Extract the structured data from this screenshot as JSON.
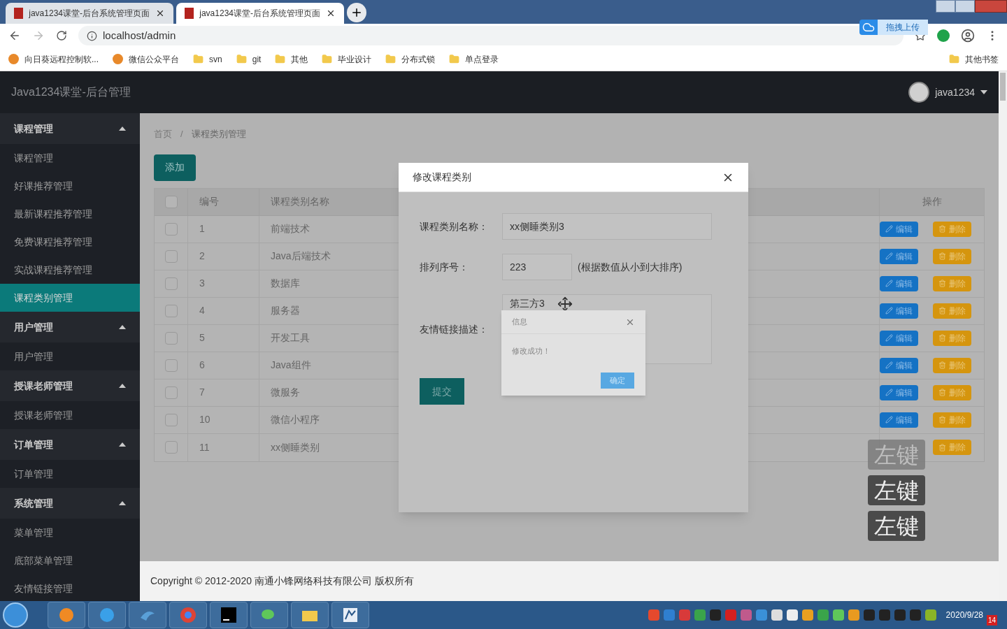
{
  "browser": {
    "tabs": [
      {
        "title": "java1234课堂-后台系统管理页面",
        "selected": false
      },
      {
        "title": "java1234课堂-后台系统管理页面",
        "selected": true
      }
    ],
    "address": "localhost/admin",
    "extension": "拖拽上传",
    "bookmarks": [
      {
        "label": "向日葵远程控制软...",
        "kind": "app"
      },
      {
        "label": "微信公众平台",
        "kind": "app"
      },
      {
        "label": "svn",
        "kind": "folder"
      },
      {
        "label": "git",
        "kind": "folder"
      },
      {
        "label": "其他",
        "kind": "folder"
      },
      {
        "label": "毕业设计",
        "kind": "folder"
      },
      {
        "label": "分布式锁",
        "kind": "folder"
      },
      {
        "label": "单点登录",
        "kind": "folder"
      }
    ],
    "other_bookmarks": "其他书签"
  },
  "header": {
    "brand": "Java1234课堂-后台管理",
    "user": "java1234"
  },
  "sidebar": [
    {
      "label": "课程管理",
      "expanded": true,
      "children": [
        {
          "label": "课程管理",
          "selected": false
        },
        {
          "label": "好课推荐管理",
          "selected": false
        },
        {
          "label": "最新课程推荐管理",
          "selected": false
        },
        {
          "label": "免费课程推荐管理",
          "selected": false
        },
        {
          "label": "实战课程推荐管理",
          "selected": false
        },
        {
          "label": "课程类别管理",
          "selected": true
        }
      ]
    },
    {
      "label": "用户管理",
      "expanded": true,
      "children": [
        {
          "label": "用户管理",
          "selected": false
        }
      ]
    },
    {
      "label": "授课老师管理",
      "expanded": true,
      "children": [
        {
          "label": "授课老师管理",
          "selected": false
        }
      ]
    },
    {
      "label": "订单管理",
      "expanded": true,
      "children": [
        {
          "label": "订单管理",
          "selected": false
        }
      ]
    },
    {
      "label": "系统管理",
      "expanded": true,
      "children": [
        {
          "label": "菜单管理",
          "selected": false
        },
        {
          "label": "底部菜单管理",
          "selected": false
        },
        {
          "label": "友情链接管理",
          "selected": false
        }
      ]
    }
  ],
  "breadcrumb": [
    "首页",
    "/",
    "课程类别管理"
  ],
  "add_button": "添加",
  "table": {
    "select_all_checked": false,
    "columns": [
      "编号",
      "课程类别名称",
      "操作"
    ],
    "rows": [
      {
        "id": "1",
        "name": "前端技术",
        "checked": false,
        "actions": [
          "编辑",
          "删除"
        ]
      },
      {
        "id": "2",
        "name": "Java后端技术",
        "checked": false,
        "actions": [
          "编辑",
          "删除"
        ]
      },
      {
        "id": "3",
        "name": "数据库",
        "checked": false,
        "actions": [
          "编辑",
          "删除"
        ]
      },
      {
        "id": "4",
        "name": "服务器",
        "checked": false,
        "actions": [
          "编辑",
          "删除"
        ]
      },
      {
        "id": "5",
        "name": "开发工具",
        "checked": false,
        "actions": [
          "编辑",
          "删除"
        ]
      },
      {
        "id": "6",
        "name": "Java组件",
        "checked": false,
        "actions": [
          "编辑",
          "删除"
        ]
      },
      {
        "id": "7",
        "name": "微服务",
        "checked": false,
        "actions": [
          "编辑",
          "删除"
        ]
      },
      {
        "id": "10",
        "name": "微信小程序",
        "checked": false,
        "actions": [
          "编辑",
          "删除"
        ]
      },
      {
        "id": "11",
        "name": "xx侧睡类别",
        "checked": false,
        "actions": [
          "删除"
        ]
      }
    ]
  },
  "modal": {
    "title": "修改课程类别",
    "fields": [
      {
        "label": "课程类别名称：",
        "value": "xx侧睡类别3",
        "kind": "input"
      },
      {
        "label": "排列序号：",
        "value": "223",
        "hint": "(根据数值从小到大排序)",
        "kind": "number"
      },
      {
        "label": "友情链接描述：",
        "value": "第三方3",
        "kind": "textarea"
      }
    ],
    "submit": "提交"
  },
  "dialog": {
    "title": "信息",
    "message": "修改成功！",
    "ok": "确定"
  },
  "key_overlays": [
    {
      "label": "左键",
      "faded": true
    },
    {
      "label": "左键",
      "faded": false
    },
    {
      "label": "左键",
      "faded": false
    }
  ],
  "footer": "Copyright © 2012-2020 南通小锋网络科技有限公司 版权所有",
  "taskbar": {
    "date": "2020/9/28",
    "badge": "14"
  }
}
